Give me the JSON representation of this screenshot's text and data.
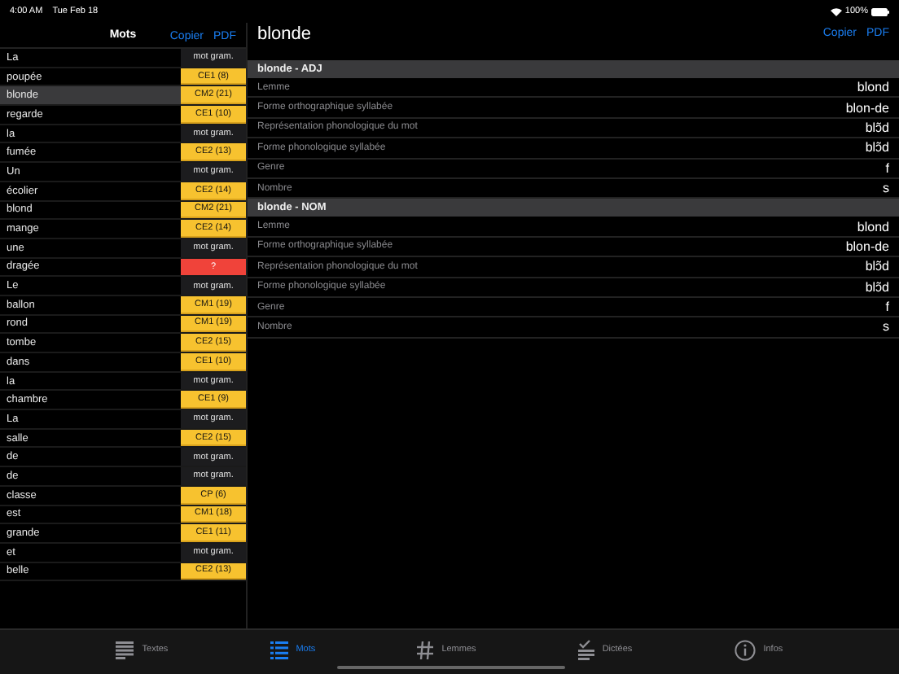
{
  "status_bar": {
    "time": "4:00 AM",
    "date": "Tue Feb 18",
    "battery": "100%"
  },
  "word_list": {
    "title": "Mots",
    "actions": [
      "Copier",
      "PDF"
    ],
    "rows": [
      {
        "word": "La",
        "badge": "mot gram.",
        "kind": "gram",
        "selected": false
      },
      {
        "word": "poupée",
        "badge": "CE1 (8)",
        "kind": "level",
        "selected": false
      },
      {
        "word": "blonde",
        "badge": "CM2 (21)",
        "kind": "level",
        "selected": true
      },
      {
        "word": "regarde",
        "badge": "CE1 (10)",
        "kind": "level",
        "selected": false
      },
      {
        "word": "la",
        "badge": "mot gram.",
        "kind": "gram",
        "selected": false
      },
      {
        "word": "fumée",
        "badge": "CE2 (13)",
        "kind": "level",
        "selected": false
      },
      {
        "word": "Un",
        "badge": "mot gram.",
        "kind": "gram",
        "selected": false
      },
      {
        "word": "écolier",
        "badge": "CE2 (14)",
        "kind": "level",
        "selected": false
      },
      {
        "word": "blond",
        "badge": "CM2 (21)",
        "kind": "level",
        "selected": false
      },
      {
        "word": "mange",
        "badge": "CE2 (14)",
        "kind": "level",
        "selected": false
      },
      {
        "word": "une",
        "badge": "mot gram.",
        "kind": "gram",
        "selected": false
      },
      {
        "word": "dragée",
        "badge": "?",
        "kind": "unknown",
        "selected": false
      },
      {
        "word": "Le",
        "badge": "mot gram.",
        "kind": "gram",
        "selected": false
      },
      {
        "word": "ballon",
        "badge": "CM1 (19)",
        "kind": "level",
        "selected": false
      },
      {
        "word": "rond",
        "badge": "CM1 (19)",
        "kind": "level",
        "selected": false
      },
      {
        "word": "tombe",
        "badge": "CE2 (15)",
        "kind": "level",
        "selected": false
      },
      {
        "word": "dans",
        "badge": "CE1 (10)",
        "kind": "level",
        "selected": false
      },
      {
        "word": "la",
        "badge": "mot gram.",
        "kind": "gram",
        "selected": false
      },
      {
        "word": "chambre",
        "badge": "CE1 (9)",
        "kind": "level",
        "selected": false
      },
      {
        "word": "La",
        "badge": "mot gram.",
        "kind": "gram",
        "selected": false
      },
      {
        "word": "salle",
        "badge": "CE2 (15)",
        "kind": "level",
        "selected": false
      },
      {
        "word": "de",
        "badge": "mot gram.",
        "kind": "gram",
        "selected": false
      },
      {
        "word": "de",
        "badge": "mot gram.",
        "kind": "gram",
        "selected": false
      },
      {
        "word": "classe",
        "badge": "CP (6)",
        "kind": "level",
        "selected": false
      },
      {
        "word": "est",
        "badge": "CM1 (18)",
        "kind": "level",
        "selected": false
      },
      {
        "word": "grande",
        "badge": "CE1 (11)",
        "kind": "level",
        "selected": false
      },
      {
        "word": "et",
        "badge": "mot gram.",
        "kind": "gram",
        "selected": false
      },
      {
        "word": "belle",
        "badge": "CE2 (13)",
        "kind": "level",
        "selected": false
      }
    ]
  },
  "detail": {
    "title": "blonde",
    "actions": [
      "Copier",
      "PDF"
    ],
    "sections": [
      {
        "header": "blonde - ADJ",
        "rows": [
          {
            "label": "Lemme",
            "value": "blond"
          },
          {
            "label": "Forme orthographique syllabée",
            "value": "blon-de"
          },
          {
            "label": "Représentation phonologique du mot",
            "value": "blɔ̃d"
          },
          {
            "label": "Forme phonologique syllabée",
            "value": "blɔ̃d"
          },
          {
            "label": "Genre",
            "value": "f"
          },
          {
            "label": "Nombre",
            "value": "s"
          }
        ]
      },
      {
        "header": "blonde - NOM",
        "rows": [
          {
            "label": "Lemme",
            "value": "blond"
          },
          {
            "label": "Forme orthographique syllabée",
            "value": "blon-de"
          },
          {
            "label": "Représentation phonologique du mot",
            "value": "blɔ̃d"
          },
          {
            "label": "Forme phonologique syllabée",
            "value": "blɔ̃d"
          },
          {
            "label": "Genre",
            "value": "f"
          },
          {
            "label": "Nombre",
            "value": "s"
          }
        ]
      }
    ]
  },
  "tab_bar": [
    {
      "label": "Textes",
      "kind": "lines",
      "selected": false
    },
    {
      "label": "Mots",
      "kind": "list",
      "selected": true
    },
    {
      "label": "Lemmes",
      "kind": "hash",
      "selected": false
    },
    {
      "label": "Dictées",
      "kind": "check",
      "selected": false
    },
    {
      "label": "Infos",
      "kind": "info",
      "selected": false
    }
  ]
}
